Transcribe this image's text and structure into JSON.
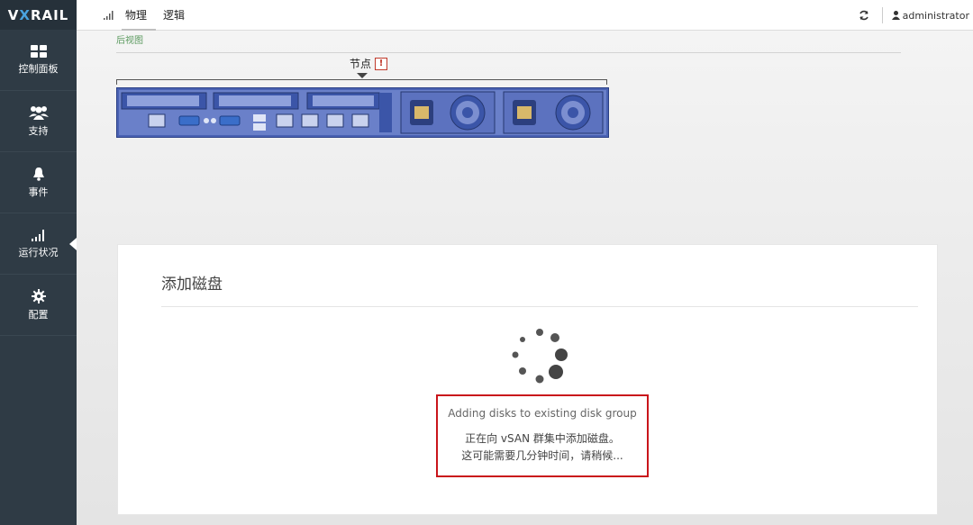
{
  "app": {
    "logo_prefix": "V",
    "logo_x": "X",
    "logo_suffix": "RAIL"
  },
  "sidebar": {
    "items": [
      {
        "label": "控制面板",
        "icon": "dashboard-icon"
      },
      {
        "label": "支持",
        "icon": "support-users-icon"
      },
      {
        "label": "事件",
        "icon": "bell-icon"
      },
      {
        "label": "运行状况",
        "icon": "signal-bars-icon",
        "active": true
      },
      {
        "label": "配置",
        "icon": "gear-icon"
      }
    ]
  },
  "header": {
    "tabs": [
      {
        "label": "物理",
        "active": true
      },
      {
        "label": "逻辑",
        "active": false
      }
    ],
    "user": "administrator"
  },
  "physical": {
    "rear_view_label": "后视图",
    "node_label": "节点",
    "node_alert": "!"
  },
  "dialog": {
    "title": "添加磁盘",
    "status_en": "Adding disks to existing disk group",
    "status_zh_line1": "正在向 vSAN 群集中添加磁盘。",
    "status_zh_line2": "这可能需要几分钟时间，请稍候..."
  },
  "colors": {
    "sidebar_bg": "#2f3b45",
    "server_blue": "#3b55a8",
    "highlight_red": "#c9151b",
    "rear_label_green": "#5b9a5f"
  }
}
